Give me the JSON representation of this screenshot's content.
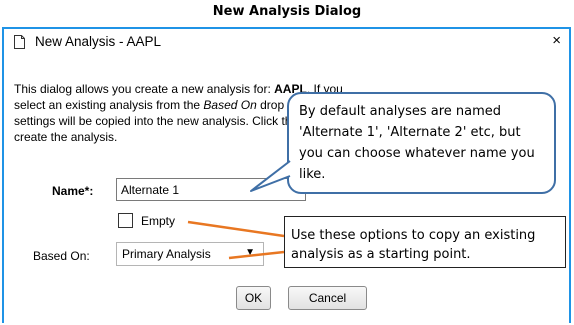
{
  "caption": "New Analysis Dialog",
  "dialog": {
    "title": "New Analysis - AAPL",
    "close_symbol": "×",
    "intro": {
      "p1": "This dialog allows you create a new analysis for: ",
      "symbol": "AAPL",
      "p2": ". If you select an existing analysis from the ",
      "based_on_italic": "Based On",
      "p3": " drop down, its settings will be copied into the new analysis. Click the OK button to create the analysis."
    },
    "name_label": "Name*:",
    "name_value": "Alternate 1",
    "empty_label": "Empty",
    "empty_checked": false,
    "based_on_label": "Based On:",
    "based_on_value": "Primary Analysis",
    "ok_label": "OK",
    "cancel_label": "Cancel"
  },
  "callouts": {
    "naming_tip": "By default analyses are named 'Alternate 1', 'Alternate 2' etc, but you can choose whatever name you like.",
    "options_tip": "Use these options to copy an existing analysis as a starting point."
  },
  "colors": {
    "dialog_border": "#1f93e6",
    "callout_border": "#3f6fa6",
    "arrow": "#e87722"
  }
}
